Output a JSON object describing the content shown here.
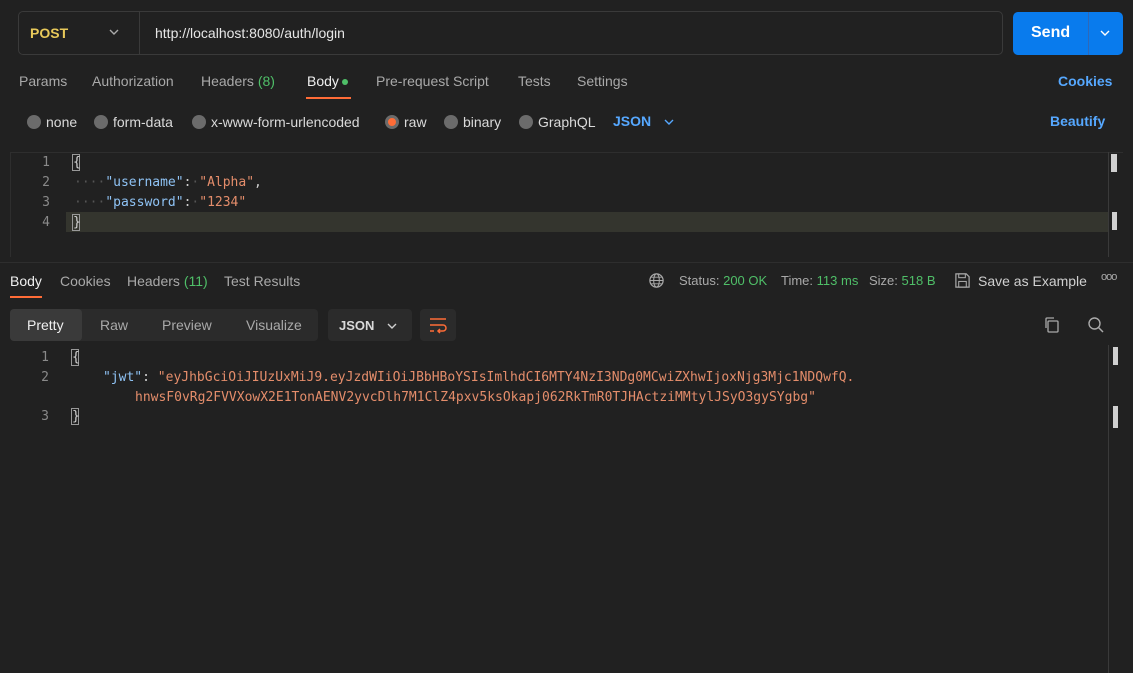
{
  "request": {
    "method": "POST",
    "url": "http://localhost:8080/auth/login",
    "send_label": "Send"
  },
  "request_tabs": {
    "params": "Params",
    "authorization": "Authorization",
    "headers": "Headers",
    "headers_count": "(8)",
    "body": "Body",
    "pre_request": "Pre-request Script",
    "tests": "Tests",
    "settings": "Settings",
    "cookies": "Cookies"
  },
  "body_types": {
    "none": "none",
    "form_data": "form-data",
    "urlencoded": "x-www-form-urlencoded",
    "raw": "raw",
    "binary": "binary",
    "graphql": "GraphQL",
    "format": "JSON",
    "beautify": "Beautify",
    "selected": "raw"
  },
  "request_body": {
    "line_numbers": [
      "1",
      "2",
      "3",
      "4"
    ],
    "open_brace": "{",
    "close_brace": "}",
    "indent": "····",
    "username_key": "\"username\"",
    "username_value": "\"Alpha\"",
    "password_key": "\"password\"",
    "password_value": "\"1234\"",
    "colon": ":",
    "comma": ","
  },
  "response_tabs": {
    "body": "Body",
    "cookies": "Cookies",
    "headers": "Headers",
    "headers_count": "(11)",
    "test_results": "Test Results"
  },
  "response_status": {
    "status_label": "Status:",
    "status_value": "200 OK",
    "time_label": "Time:",
    "time_value": "113 ms",
    "size_label": "Size:",
    "size_value": "518 B",
    "save_example": "Save as Example",
    "more": "ooo"
  },
  "response_view": {
    "pretty": "Pretty",
    "raw": "Raw",
    "preview": "Preview",
    "visualize": "Visualize",
    "format": "JSON"
  },
  "response_body": {
    "line_numbers": [
      "1",
      "2",
      "3"
    ],
    "open_brace": "{",
    "close_brace": "}",
    "jwt_key": "\"jwt\"",
    "colon": ":",
    "jwt_value_line1": "\"eyJhbGciOiJIUzUxMiJ9.eyJzdWIiOiJBbHBoYSIsImlhdCI6MTY4NzI3NDg0MCwiZXhwIjoxNjg3Mjc1NDQwfQ.",
    "jwt_value_line2": "hnwsF0vRg2FVVXowX2E1TonAENV2yvcDlh7M1ClZ4pxv5ksOkapj062RkTmR0TJHActziMMtylJSyO3gySYgbg\""
  },
  "colors": {
    "accent": "#ff6c37",
    "send": "#097bed",
    "link": "#56a8ff",
    "success": "#4fbf68",
    "method": "#e8c95a"
  }
}
